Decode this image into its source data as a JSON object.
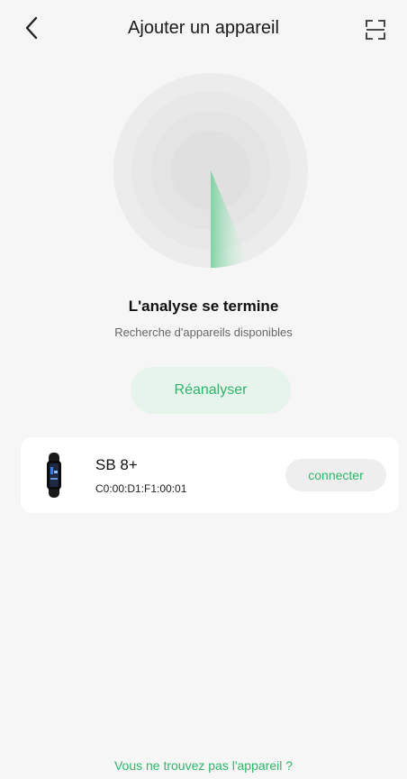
{
  "header": {
    "title": "Ajouter un appareil",
    "back_icon": "chevron-left-icon",
    "scan_icon": "qr-scan-icon"
  },
  "scan": {
    "radar_icon": "radar-sweep-icon",
    "status_title": "L'analyse se termine",
    "status_subtitle": "Recherche d'appareils disponibles",
    "rescan_label": "Réanalyser"
  },
  "devices": [
    {
      "icon": "smart-band-icon",
      "name": "SB 8+",
      "mac": "C0:00:D1:F1:00:01",
      "connect_label": "connecter"
    }
  ],
  "footer": {
    "not_found_link": "Vous ne trouvez pas l'appareil ?"
  },
  "colors": {
    "accent": "#2fb56b",
    "accent_light": "#e6f4ec",
    "background": "#f6f6f6",
    "card": "#ffffff"
  }
}
